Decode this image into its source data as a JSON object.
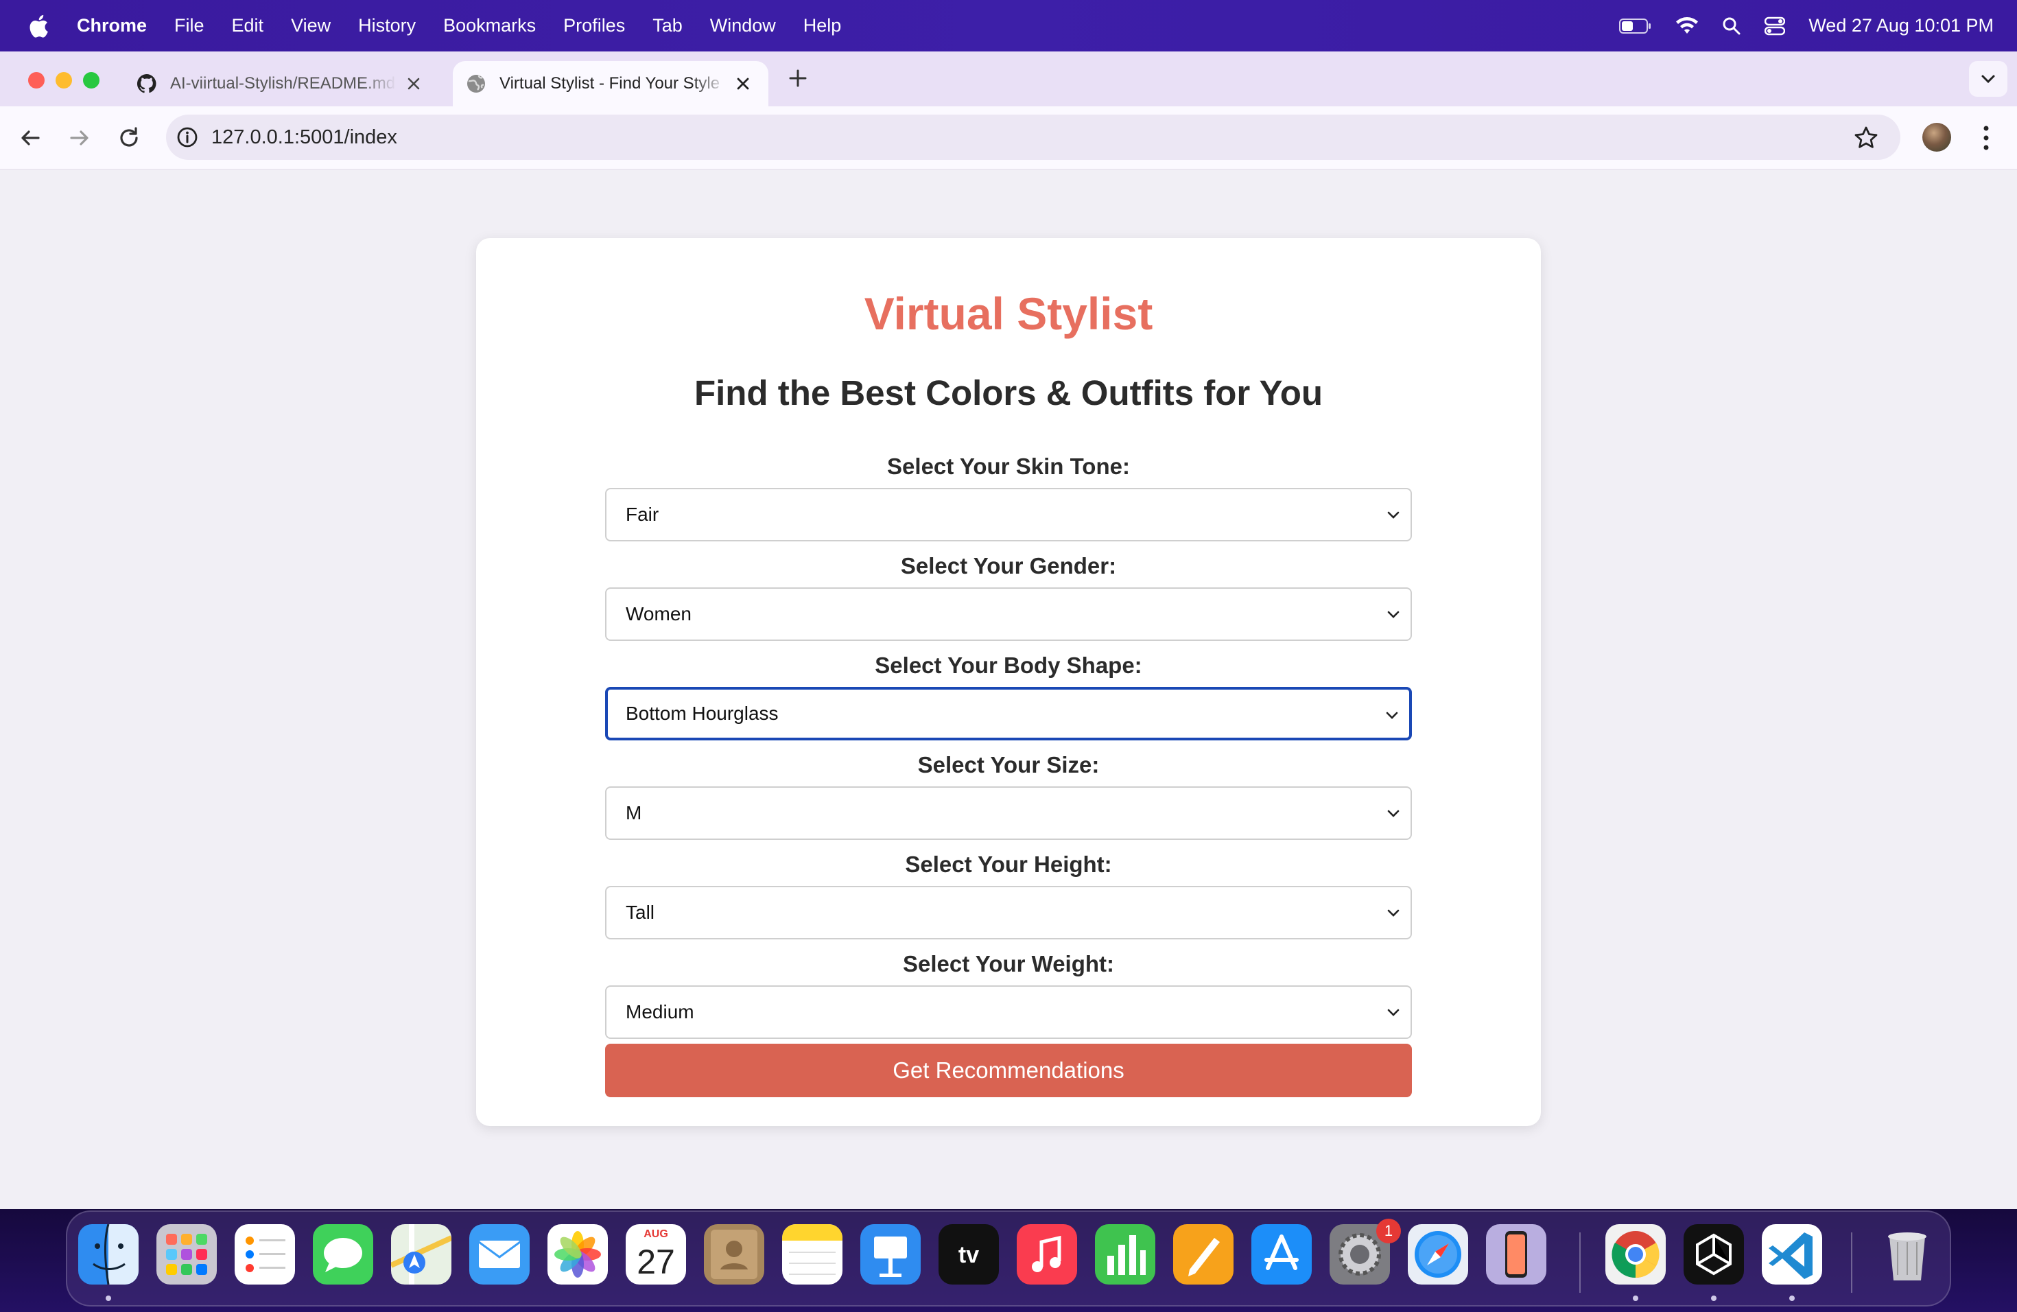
{
  "menubar": {
    "app_name": "Chrome",
    "items": [
      "File",
      "Edit",
      "View",
      "History",
      "Bookmarks",
      "Profiles",
      "Tab",
      "Window",
      "Help"
    ],
    "datetime": "Wed 27 Aug  10:01 PM"
  },
  "browser": {
    "tabs": [
      {
        "title": "AI-viirtual-Stylish/README.md",
        "icon": "github-icon",
        "active": false
      },
      {
        "title": "Virtual Stylist - Find Your Style",
        "icon": "globe-icon",
        "active": true
      }
    ],
    "url": "127.0.0.1:5001/index"
  },
  "page": {
    "title": "Virtual Stylist",
    "subtitle": "Find the Best Colors & Outfits for You",
    "fields": [
      {
        "label": "Select Your Skin Tone:",
        "value": "Fair"
      },
      {
        "label": "Select Your Gender:",
        "value": "Women"
      },
      {
        "label": "Select Your Body Shape:",
        "value": "Bottom Hourglass"
      },
      {
        "label": "Select Your Size:",
        "value": "M"
      },
      {
        "label": "Select Your Height:",
        "value": "Tall"
      },
      {
        "label": "Select Your Weight:",
        "value": "Medium"
      }
    ],
    "submit_label": "Get Recommendations"
  },
  "dock": {
    "apps": [
      "finder",
      "launchpad",
      "reminders",
      "messages",
      "maps",
      "mail",
      "photos",
      "calendar",
      "contacts",
      "notes",
      "keynote",
      "apple-tv",
      "music",
      "numbers",
      "pages",
      "app-store",
      "system-settings",
      "safari",
      "iphone-mirroring",
      "chrome",
      "unity",
      "vscode",
      "trash"
    ],
    "calendar_month": "AUG",
    "calendar_day": "27",
    "tv_label": "tv",
    "settings_badge": "1"
  },
  "colors": {
    "title": "#e76f5f",
    "button": "#d96352",
    "focus_border": "#1a48b5"
  }
}
